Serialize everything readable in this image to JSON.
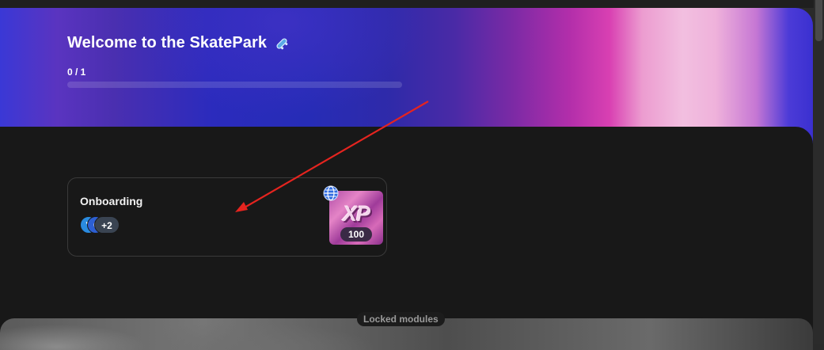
{
  "hero": {
    "title": "Welcome to the SkatePark",
    "title_icon": "skateboard-icon",
    "progress_text": "0 / 1",
    "progress_fraction": 0
  },
  "module": {
    "title": "Onboarding",
    "avatars": [
      {
        "icon": "skater-avatar-icon",
        "color": "#2a8be0"
      },
      {
        "icon": "avatar-icon",
        "color": "#2d5fd3"
      }
    ],
    "avatars_more": "+2",
    "thumbnail_text": "XP",
    "xp_value": "100",
    "globe_icon": "globe-icon"
  },
  "locked": {
    "label": "Locked modules"
  },
  "colors": {
    "annotation_arrow": "#e5241f",
    "content_bg": "#181818",
    "card_border": "#3a3a3a"
  }
}
